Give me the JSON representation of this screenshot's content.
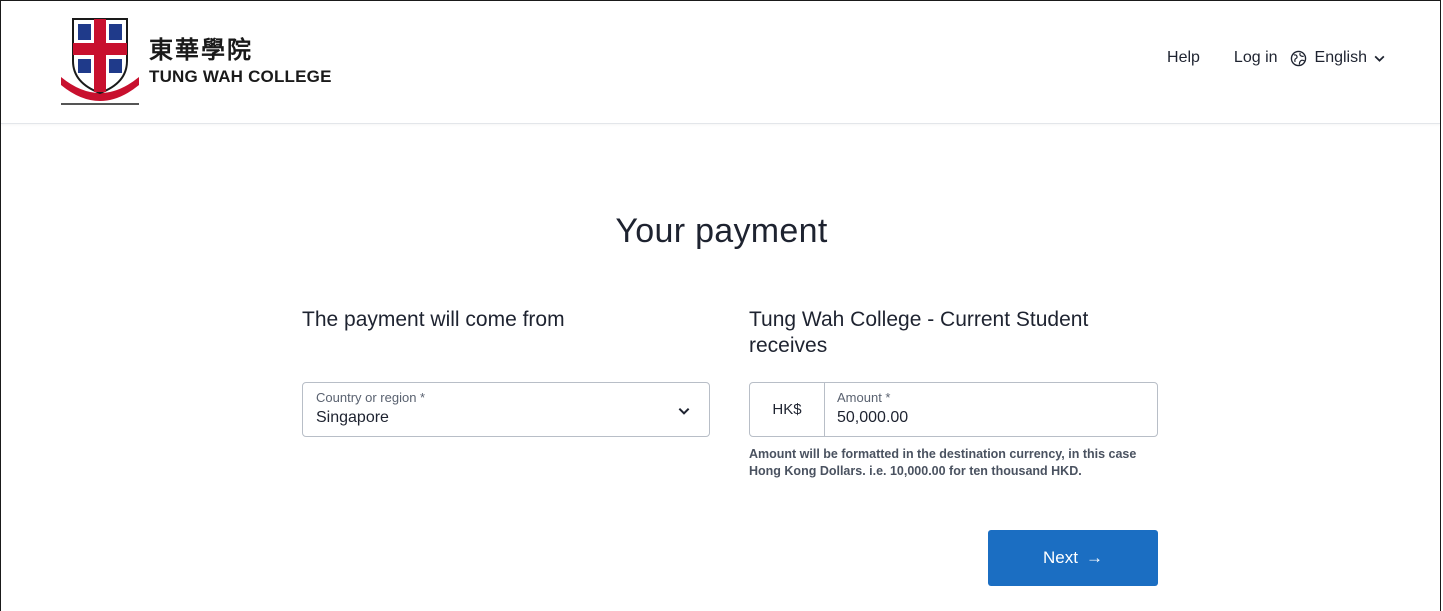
{
  "header": {
    "logo_zh": "東華學院",
    "logo_en": "TUNG WAH COLLEGE",
    "nav": {
      "help": "Help",
      "login": "Log in",
      "language": "English"
    }
  },
  "main": {
    "title": "Your payment",
    "from": {
      "heading": "The payment will come from",
      "country_label": "Country or region *",
      "country_value": "Singapore"
    },
    "to": {
      "heading": "Tung Wah College - Current Student receives",
      "currency": "HK$",
      "amount_label": "Amount *",
      "amount_value": "50,000.00",
      "hint": "Amount will be formatted in the destination currency, in this case Hong Kong Dollars. i.e. 10,000.00 for ten thousand HKD."
    },
    "next_label": "Next",
    "next_arrow": "→"
  },
  "colors": {
    "primary": "#1b6ec2",
    "text": "#1e2330",
    "border": "#b8bec7",
    "crest_red": "#c8102e",
    "crest_blue": "#1f3a8a"
  },
  "icons": {
    "globe": "globe-icon",
    "chevron": "chevron-down-icon",
    "arrow": "arrow-right-icon"
  }
}
